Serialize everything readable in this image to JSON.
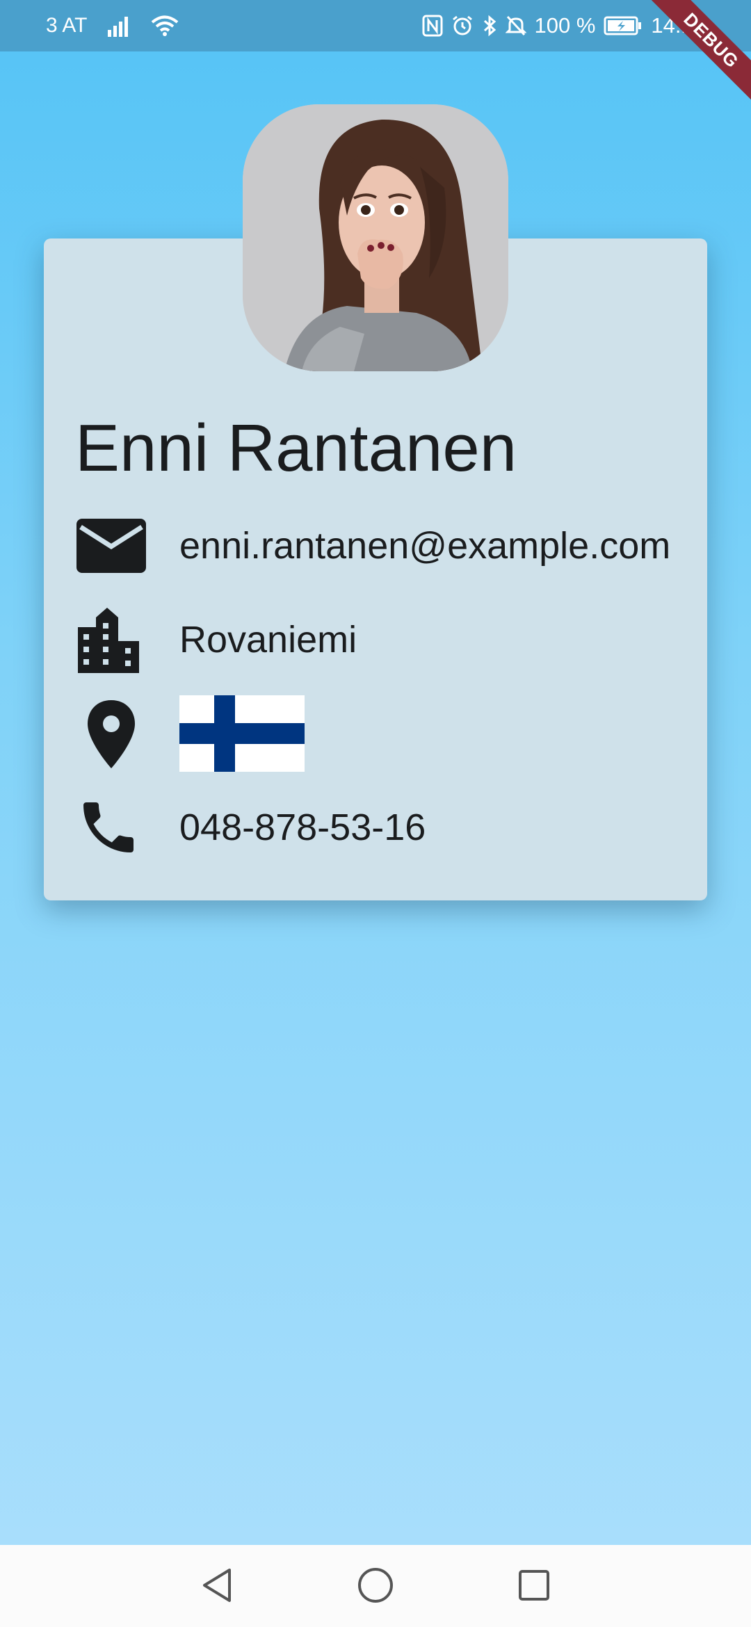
{
  "status_bar": {
    "carrier": "3 AT",
    "battery_percent": "100 %",
    "time": "14:16",
    "icons": [
      "signal-icon",
      "wifi-icon",
      "nfc-icon",
      "alarm-icon",
      "bluetooth-icon",
      "mute-icon",
      "battery-icon"
    ]
  },
  "debug_banner": "DEBUG",
  "profile": {
    "name": "Enni Rantanen",
    "email": "enni.rantanen@example.com",
    "city": "Rovaniemi",
    "phone": "048-878-53-16",
    "country_flag": "finland-flag",
    "icons": {
      "email": "mail-icon",
      "city": "city-icon",
      "location": "location-pin-icon",
      "phone": "phone-icon"
    }
  },
  "nav_bar": {
    "buttons": [
      "back-button",
      "home-button",
      "recents-button"
    ]
  },
  "colors": {
    "background_top": "#54c3f6",
    "background_bottom": "#acdffc",
    "status_bar": "#4aa0cc",
    "card": "#cfe1ea",
    "debug_ribbon": "#8b2a37",
    "flag_blue": "#003580"
  }
}
